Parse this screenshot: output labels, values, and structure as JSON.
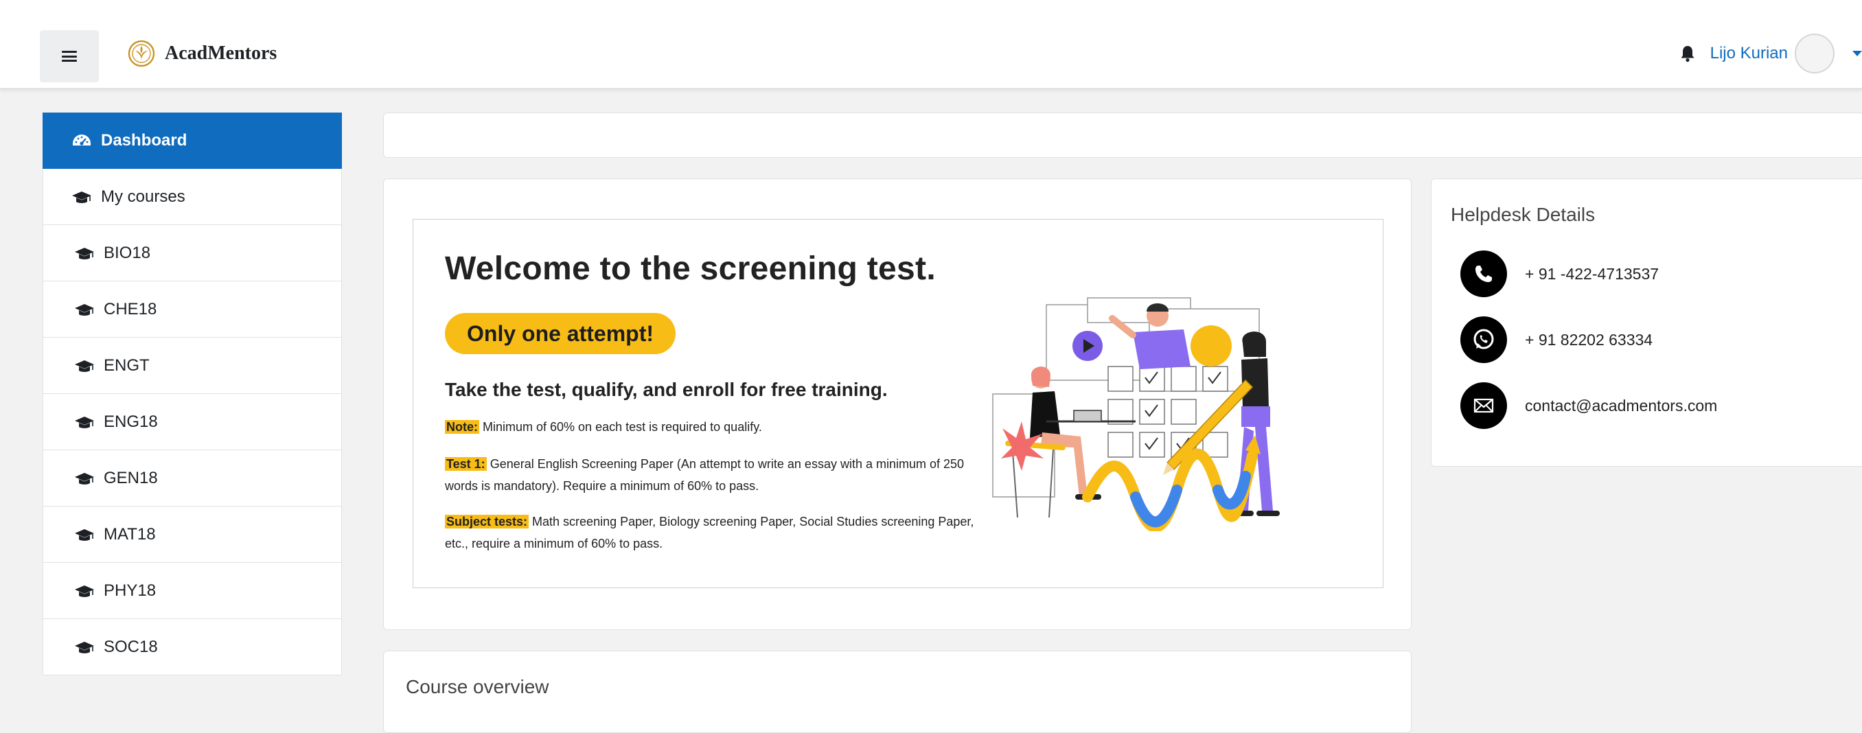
{
  "navbar": {
    "brand": "AcadMentors",
    "user_name": "Lijo Kurian"
  },
  "sidebar": {
    "items": [
      {
        "label": "Dashboard",
        "icon": "dashboard-icon",
        "active": true
      },
      {
        "label": "My courses",
        "icon": "graduation-cap-icon"
      },
      {
        "label": "BIO18",
        "icon": "graduation-cap-icon"
      },
      {
        "label": "CHE18",
        "icon": "graduation-cap-icon"
      },
      {
        "label": "ENGT",
        "icon": "graduation-cap-icon"
      },
      {
        "label": "ENG18",
        "icon": "graduation-cap-icon"
      },
      {
        "label": "GEN18",
        "icon": "graduation-cap-icon"
      },
      {
        "label": "MAT18",
        "icon": "graduation-cap-icon"
      },
      {
        "label": "PHY18",
        "icon": "graduation-cap-icon"
      },
      {
        "label": "SOC18",
        "icon": "graduation-cap-icon"
      }
    ]
  },
  "banner": {
    "title": "Welcome to the screening test.",
    "pill": "Only one attempt!",
    "tagline": "Take the test, qualify, and enroll for free training.",
    "note_label": "Note:",
    "note_text": " Minimum of 60% on each test is required to qualify.",
    "test1_label": "Test 1:",
    "test1_text": " General English Screening Paper (An attempt to write an essay with a minimum of 250 words is mandatory). Require a minimum of 60% to pass.",
    "subject_label": "Subject tests:",
    "subject_text": " Math screening Paper, Biology screening Paper, Social Studies screening Paper, etc., require a minimum of 60% to pass."
  },
  "helpdesk": {
    "title": "Helpdesk Details",
    "phone": "+ 91 -422-4713537",
    "whatsapp": "+ 91 82202 63334",
    "email": "contact@acadmentors.com"
  },
  "overview": {
    "title": "Course overview"
  },
  "colors": {
    "primary": "#0f6cbf",
    "highlight": "#f8bc17",
    "page_bg": "#f2f2f2"
  }
}
